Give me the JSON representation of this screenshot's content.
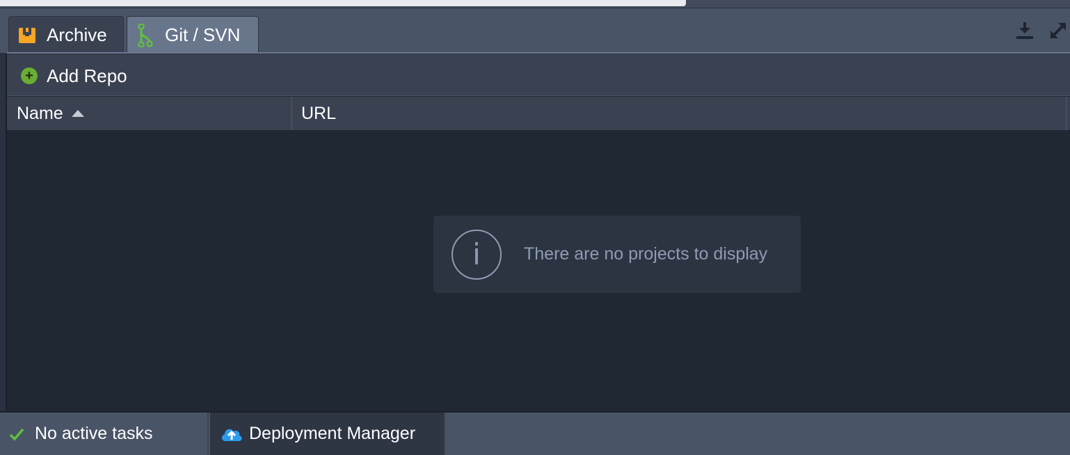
{
  "tabs": [
    {
      "label": "Archive",
      "icon": "archive-icon",
      "active": false
    },
    {
      "label": "Git / SVN",
      "icon": "git-branch-icon",
      "active": true
    }
  ],
  "toolbar": {
    "add_repo_label": "Add Repo"
  },
  "header_tools": [
    "download-icon",
    "expand-icon"
  ],
  "grid": {
    "columns": [
      {
        "label": "Name",
        "sort": "ascending"
      },
      {
        "label": "URL"
      }
    ],
    "rows": [],
    "empty_message": "There are no projects to display",
    "empty_icon_glyph": "i"
  },
  "statusbar": {
    "tasks_label": "No active tasks",
    "deploy_label": "Deployment Manager"
  },
  "colors": {
    "accent_green": "#6aad34",
    "archive_orange": "#f5a623",
    "git_green": "#5fbf3f",
    "cloud_blue": "#2e9bea"
  }
}
